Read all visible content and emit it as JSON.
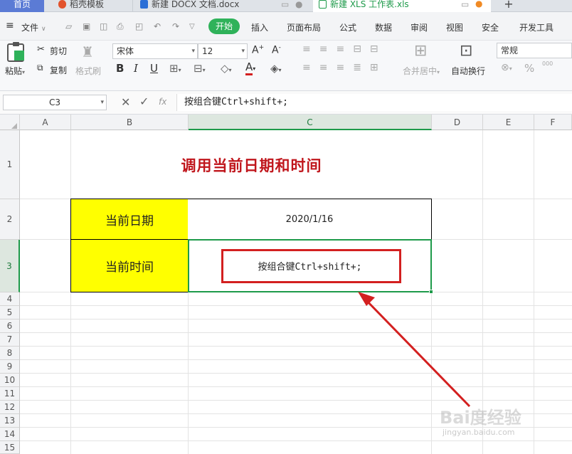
{
  "tabs": [
    {
      "label": "首页",
      "active": false
    },
    {
      "label": "稻壳模板",
      "active": false
    },
    {
      "label": "新建 DOCX 文档.docx",
      "active": false
    },
    {
      "label": "新建 XLS 工作表.xls",
      "active": true
    }
  ],
  "tab_new_label": "+",
  "menu": {
    "file": "文件",
    "items": [
      "开始",
      "插入",
      "页面布局",
      "公式",
      "数据",
      "审阅",
      "视图",
      "安全",
      "开发工具"
    ]
  },
  "ribbon": {
    "paste": "粘贴",
    "cut": "剪切",
    "copy": "复制",
    "format_painter": "格式刷",
    "font_name": "宋体",
    "font_size": "12",
    "merge_center": "合并居中",
    "wrap_text": "自动换行",
    "number_format": "常规",
    "percent": "%",
    "thousands": "000"
  },
  "formula_bar": {
    "name_box": "C3",
    "fx": "fx",
    "content": "按组合键Ctrl+shift+;"
  },
  "columns": [
    "A",
    "B",
    "C",
    "D",
    "E",
    "F"
  ],
  "rows": [
    "1",
    "2",
    "3",
    "4",
    "5",
    "6",
    "7",
    "8",
    "9",
    "10",
    "11",
    "12",
    "13",
    "14",
    "15"
  ],
  "sheet": {
    "title": "调用当前日期和时间",
    "label_date": "当前日期",
    "value_date": "2020/1/16",
    "label_time": "当前时间",
    "value_time": "按组合键Ctrl+shift+;"
  },
  "watermark": {
    "brand": "Bai度经验",
    "url": "jingyan.baidu.com"
  },
  "colors": {
    "title_red": "#c0161c",
    "yellow_fill": "#ffff00",
    "active_green": "#1e9a4a",
    "annotation_red": "#d32020"
  }
}
